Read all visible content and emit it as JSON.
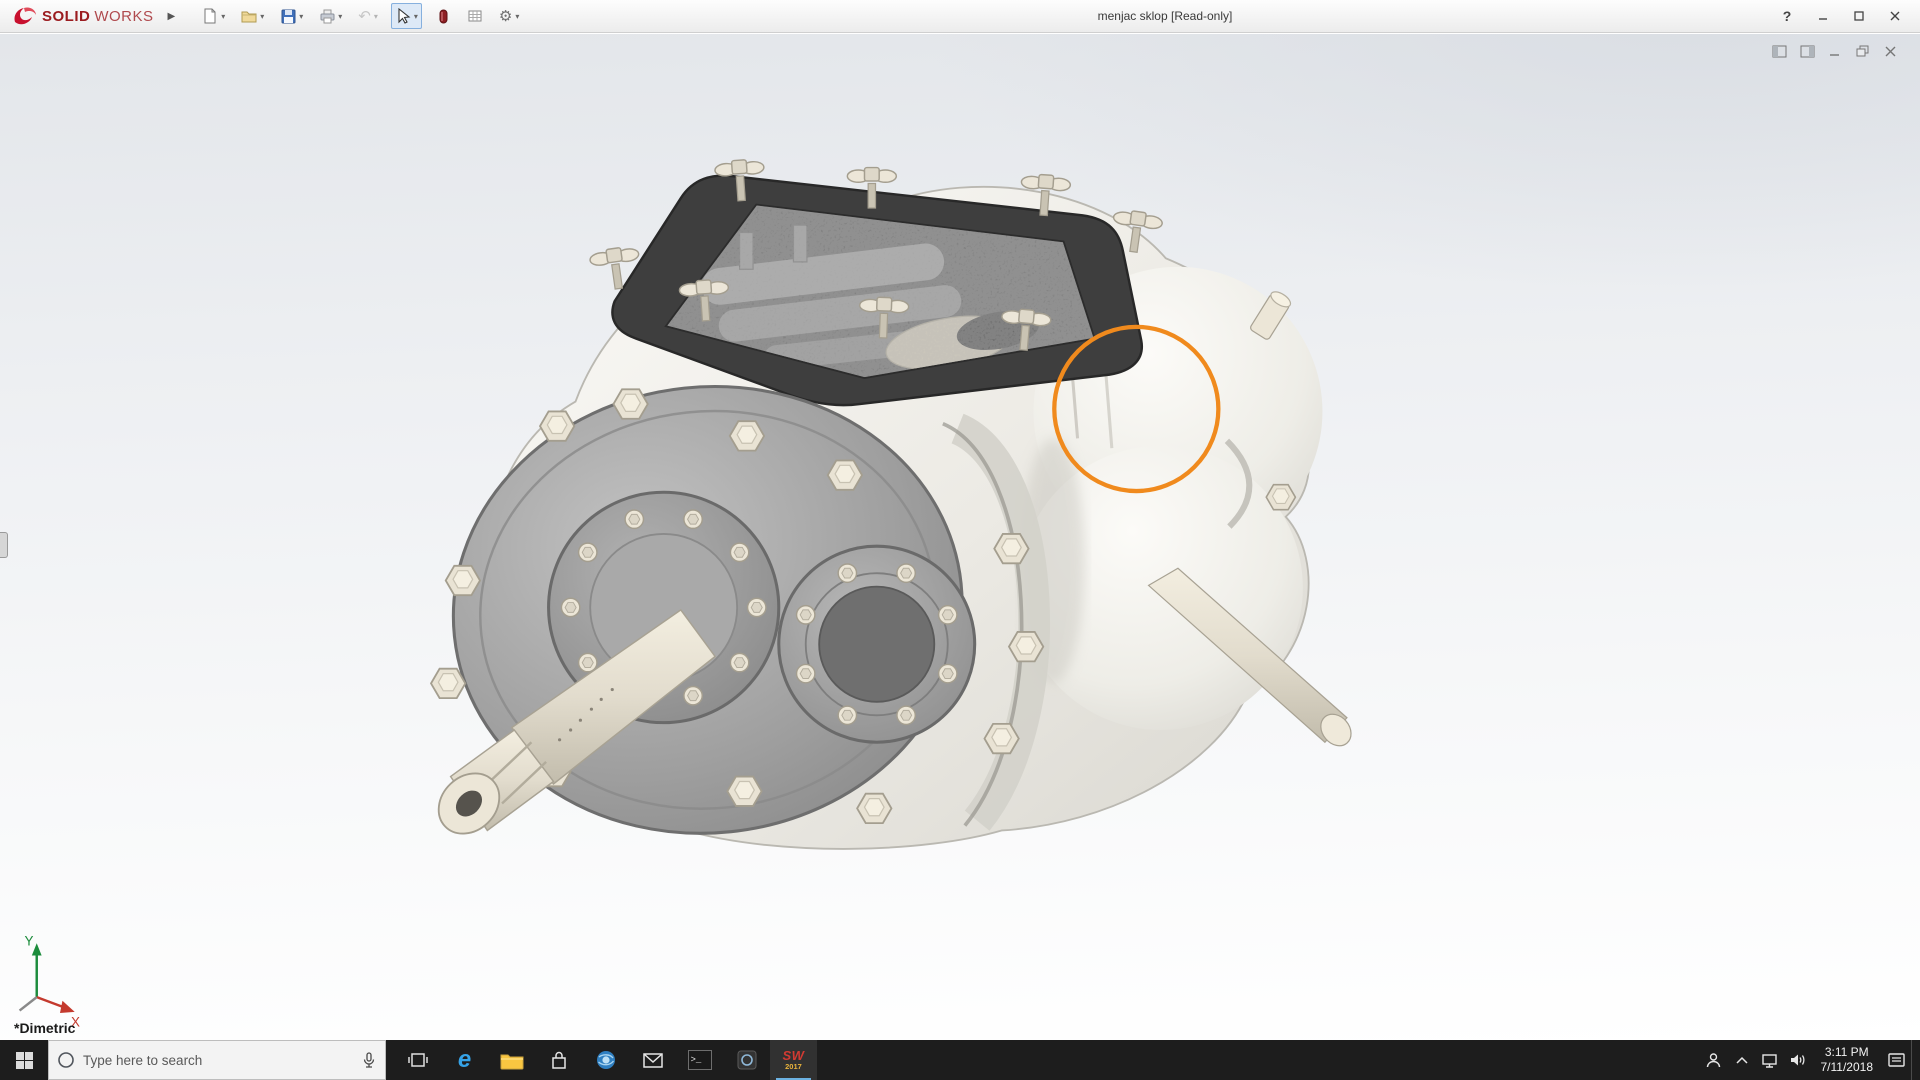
{
  "app": {
    "brand": {
      "solid": "SOLID",
      "works": "WORKS"
    },
    "title": "menjac sklop [Read-only]"
  },
  "icons": {
    "flyout_arrow": "▶",
    "caret": "▾",
    "undo": "↶",
    "gear": "⚙",
    "help": "?",
    "close": "×",
    "edge_logo": "e",
    "terminal_prompt": ">_"
  },
  "viewport": {
    "view_label": "*Dimetric",
    "axes": {
      "x": "X",
      "y": "Y"
    },
    "annotation_color": "#F08A1D"
  },
  "taskbar": {
    "search_placeholder": "Type here to search",
    "solidworks_badge": {
      "label": "SW",
      "year": "2017"
    },
    "clock": {
      "time": "3:11 PM",
      "date": "7/11/2018"
    }
  },
  "colors": {
    "brand_red": "#C8102E",
    "accent_orange": "#F08A1D",
    "taskbar_bg": "#1d1d1d"
  }
}
